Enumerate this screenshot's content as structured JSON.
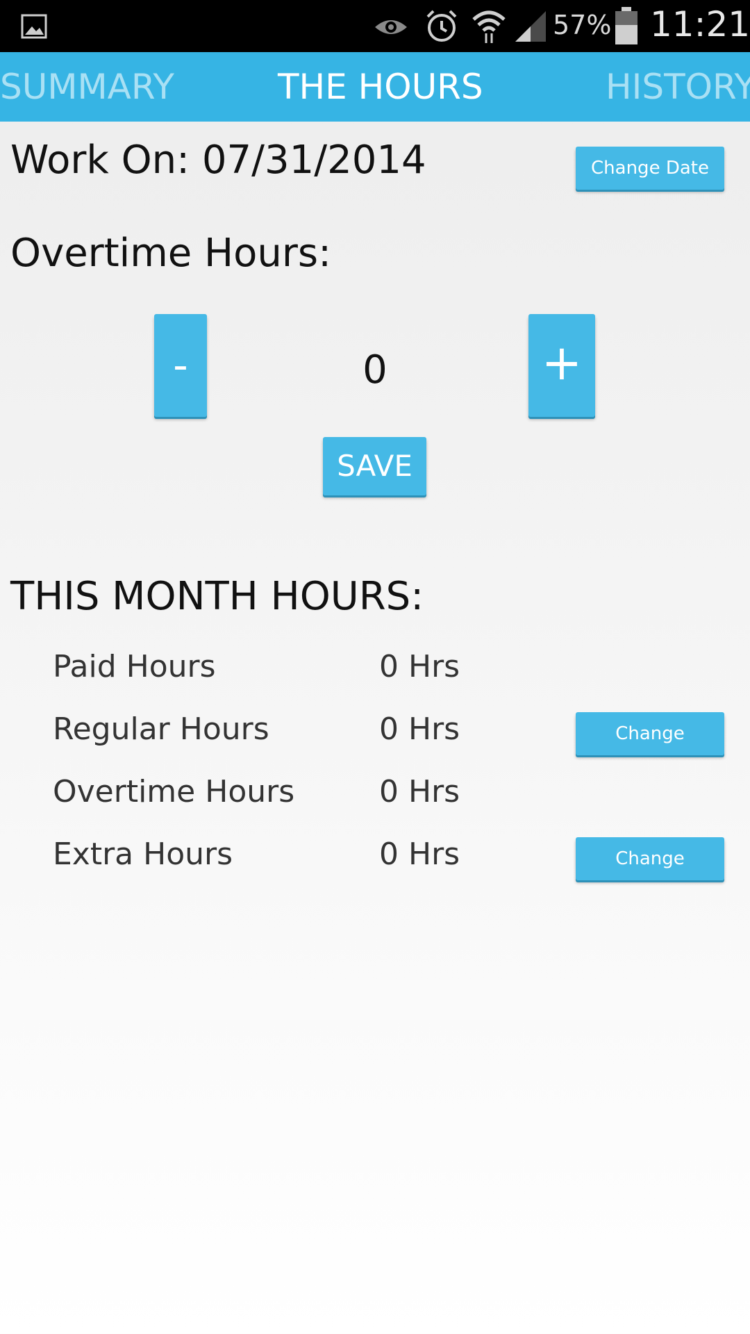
{
  "status_bar": {
    "battery": "57%",
    "time": "11:21",
    "icons": [
      "image-icon",
      "eye-icon",
      "alarm-icon",
      "wifi-icon",
      "signal-icon",
      "battery-icon"
    ]
  },
  "tabs": [
    {
      "label": "SUMMARY",
      "active": false
    },
    {
      "label": "THE HOURS",
      "active": true
    },
    {
      "label": "HISTORY",
      "active": false
    }
  ],
  "work_on": {
    "label": "Work On: 07/31/2014",
    "change_button": "Change Date"
  },
  "overtime": {
    "label": "Overtime Hours:",
    "minus": "-",
    "value": "0",
    "plus": "+",
    "save": "SAVE"
  },
  "month": {
    "heading": "THIS MONTH HOURS:",
    "rows": [
      {
        "label": "Paid Hours",
        "value": "0 Hrs"
      },
      {
        "label": "Regular Hours",
        "value": "0 Hrs",
        "button": "Change"
      },
      {
        "label": "Overtime Hours",
        "value": "0 Hrs"
      },
      {
        "label": "Extra Hours",
        "value": "0 Hrs",
        "button": "Change"
      }
    ]
  },
  "colors": {
    "accent": "#36b4e4",
    "button": "#45b9e6",
    "inactive_tab": "#a9e0f4"
  }
}
